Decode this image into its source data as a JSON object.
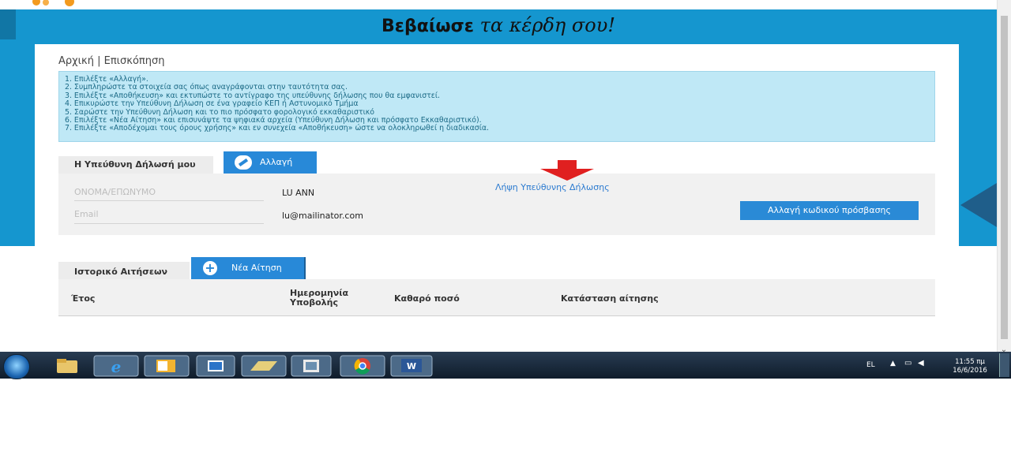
{
  "banner": {
    "title_bold": "Βεβαίωσε",
    "title_italic": "τα κέρδη σου!"
  },
  "breadcrumb": "Αρχική | Επισκόπηση",
  "instructions": [
    "1. Επιλέξτε «Αλλαγή».",
    "2. Συμπληρώστε τα στοιχεία σας όπως αναγράφονται στην ταυτότητα σας.",
    "3. Επιλέξτε «Αποθήκευση» και εκτυπώστε το αντίγραφο της υπεύθυνης δήλωσης που θα εμφανιστεί.",
    "4. Επικυρώστε την Υπεύθυνη Δήλωση σε ένα γραφείο ΚΕΠ ή Αστυνομικό Τμήμα",
    "5. Σαρώστε την Υπεύθυνη Δήλωση και το πιο πρόσφατο φορολογικό εκκαθαριστικό",
    "6. Επιλέξτε «Νέα Αίτηση» και επισυνάψτε τα ψηφιακά αρχεία (Υπεύθυνη Δήλωση και πρόσφατο Εκκαθαριστικό).",
    "7. Επιλέξτε «Αποδέχομαι τους όρους χρήσης» και εν συνεχεία «Αποθήκευση» ώστε να ολοκληρωθεί η διαδικασία."
  ],
  "declaration": {
    "tab_label": "Η Υπεύθυνη Δήλωσή μου",
    "change_button": "Αλλαγή",
    "name_label": "ΟΝΟΜΑ/ΕΠΩΝΥΜΟ",
    "name_value": "LU ANN",
    "email_label": "Email",
    "email_value": "lu@mailinator.com",
    "download_link": "Λήψη Υπεύθυνης Δήλωσης",
    "password_button": "Αλλαγή κωδικού πρόσβασης"
  },
  "history": {
    "tab_label": "Ιστορικό Αιτήσεων",
    "new_button": "Νέα Αίτηση",
    "columns": [
      "Έτος",
      "Ημερομηνία Υποβολής",
      "Καθαρό ποσό",
      "Κατάσταση αίτησης"
    ]
  },
  "taskbar": {
    "language": "EL",
    "time": "11:55 πμ",
    "date": "16/6/2016",
    "apps": [
      "file-explorer",
      "internet-explorer",
      "outlook",
      "media-player",
      "folder-window",
      "image-viewer",
      "chrome",
      "word"
    ]
  },
  "colors": {
    "banner": "#1596cf",
    "button": "#2889d8",
    "instructions_bg": "#bfe8f6",
    "arrow": "#e02020"
  }
}
